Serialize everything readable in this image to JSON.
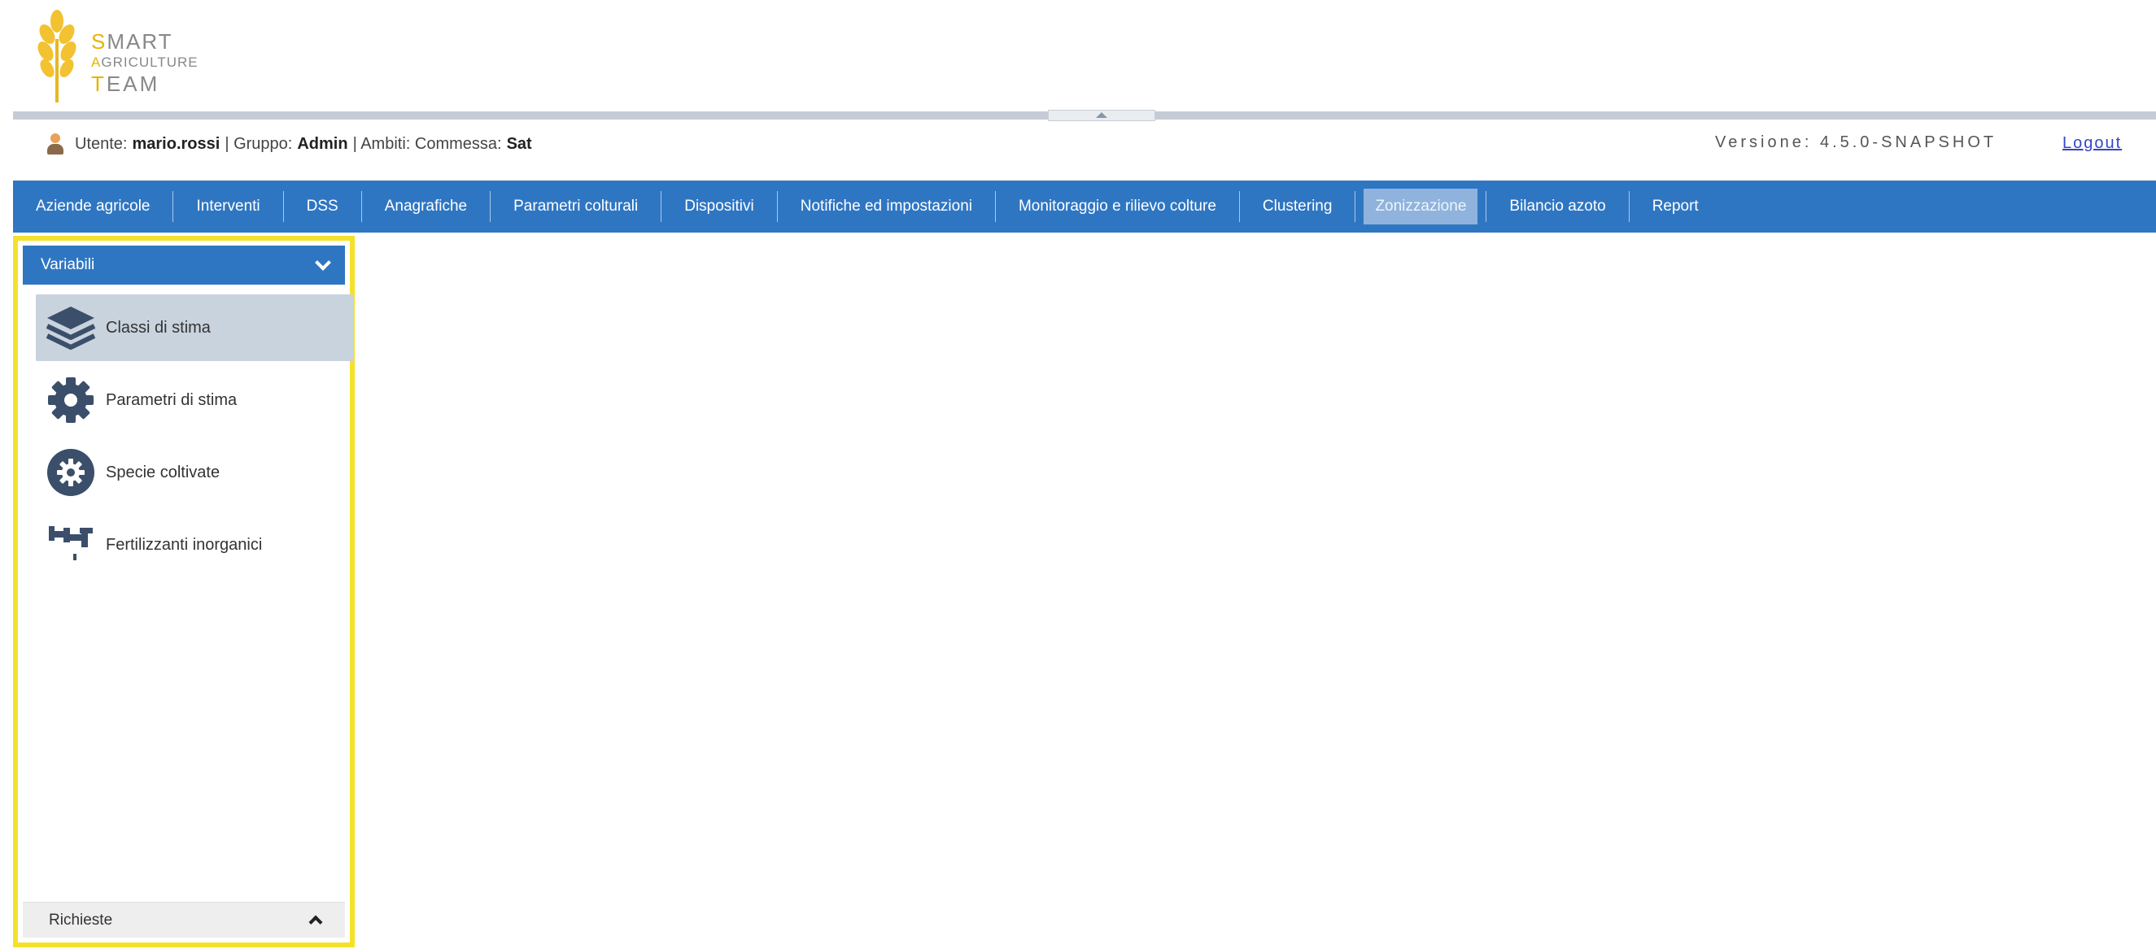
{
  "brand": {
    "line1_cap": "S",
    "line1_rest": "MART",
    "line2_cap": "A",
    "line2_rest": "GRICULTURE",
    "line3_cap": "T",
    "line3_rest": "EAM",
    "accent": "#e6b400"
  },
  "user": {
    "label_user": "Utente:",
    "username": "mario.rossi",
    "label_group": "| Gruppo:",
    "group": "Admin",
    "label_scope": "| Ambiti: Commessa:",
    "scope": "Sat"
  },
  "version": "Versione: 4.5.0-SNAPSHOT",
  "logout": "Logout",
  "nav": {
    "items": [
      "Aziende agricole",
      "Interventi",
      "DSS",
      "Anagrafiche",
      "Parametri colturali",
      "Dispositivi",
      "Notifiche ed impostazioni",
      "Monitoraggio e rilievo colture",
      "Clustering",
      "Zonizzazione",
      "Bilancio azoto",
      "Report"
    ],
    "active": "Zonizzazione",
    "color": "#2f76c2"
  },
  "sidebar": {
    "header": "Variabili",
    "items": [
      {
        "label": "Classi di stima",
        "icon": "layers-icon",
        "selected": true
      },
      {
        "label": "Parametri di stima",
        "icon": "gear-icon",
        "selected": false
      },
      {
        "label": "Specie coltivate",
        "icon": "plant-gear-icon",
        "selected": false
      },
      {
        "label": "Fertilizzanti inorganici",
        "icon": "pipes-icon",
        "selected": false
      }
    ],
    "footer": "Richieste",
    "highlight": "#f3e22c"
  }
}
